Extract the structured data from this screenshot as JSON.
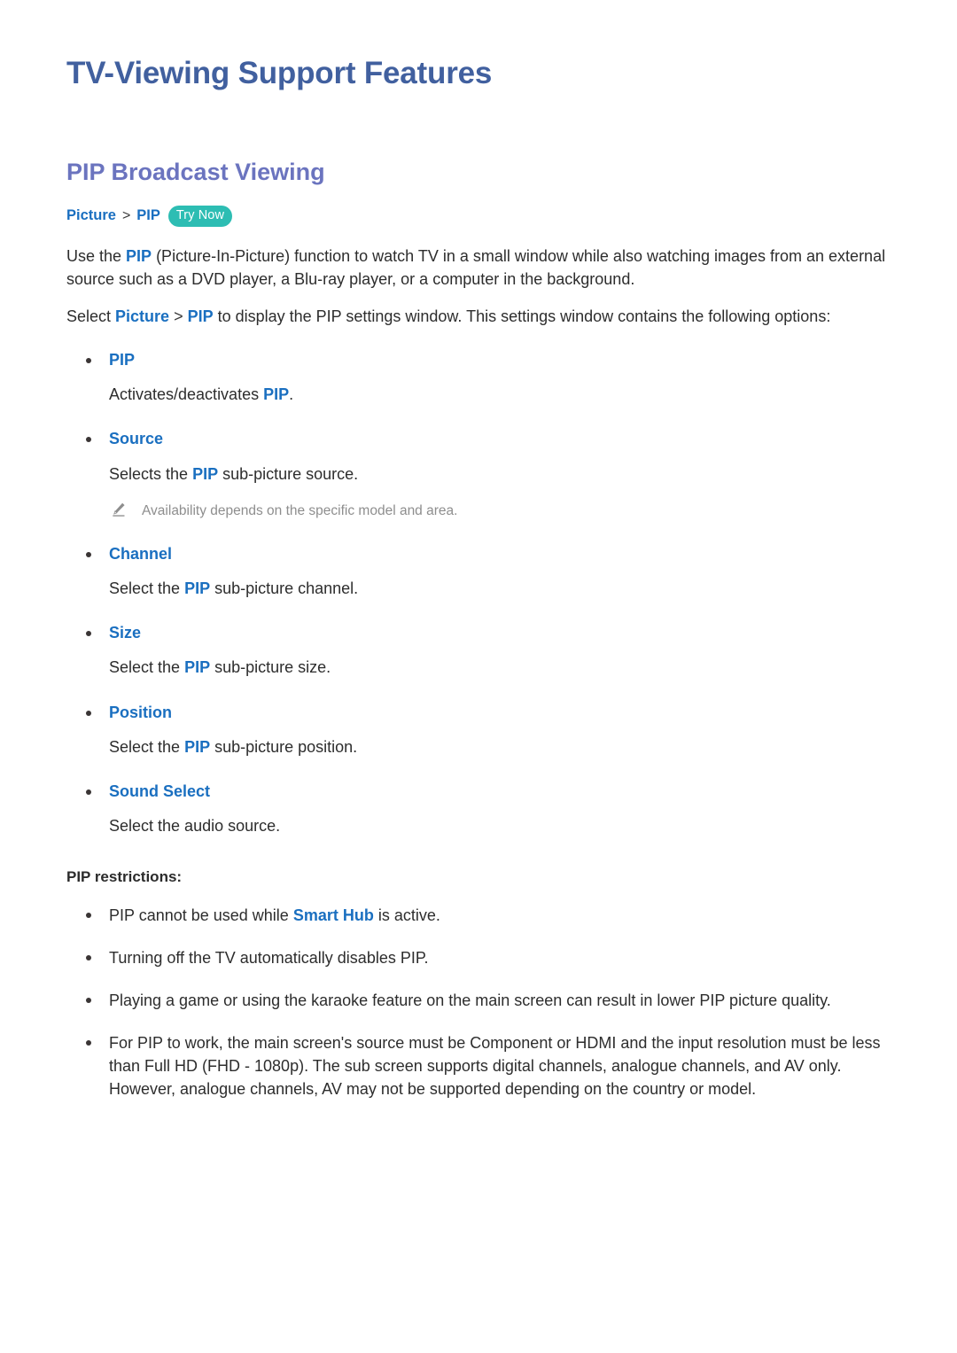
{
  "document": {
    "title": "TV-Viewing Support Features",
    "section_title": "PIP Broadcast Viewing"
  },
  "breadcrumb": {
    "first": "Picture",
    "separator": ">",
    "second": "PIP",
    "badge": "Try Now"
  },
  "intro": {
    "p1_a": "Use the ",
    "p1_kw": "PIP",
    "p1_b": " (Picture-In-Picture) function to watch TV in a small window while also watching images from an external source such as a DVD player, a Blu-ray player, or a computer in the background.",
    "p2_a": "Select ",
    "p2_kw1": "Picture",
    "p2_sep": " > ",
    "p2_kw2": "PIP",
    "p2_b": " to display the PIP settings window. This settings window contains the following options:"
  },
  "options": [
    {
      "label": "PIP",
      "desc_a": "Activates/deactivates ",
      "desc_kw": "PIP",
      "desc_b": ".",
      "note": null
    },
    {
      "label": "Source",
      "desc_a": "Selects the ",
      "desc_kw": "PIP",
      "desc_b": " sub-picture source.",
      "note": "Availability depends on the specific model and area."
    },
    {
      "label": "Channel",
      "desc_a": "Select the ",
      "desc_kw": "PIP",
      "desc_b": " sub-picture channel.",
      "note": null
    },
    {
      "label": "Size",
      "desc_a": "Select the ",
      "desc_kw": "PIP",
      "desc_b": " sub-picture size.",
      "note": null
    },
    {
      "label": "Position",
      "desc_a": "Select the ",
      "desc_kw": "PIP",
      "desc_b": " sub-picture position.",
      "note": null
    },
    {
      "label": "Sound Select",
      "desc_a": "Select the audio source.",
      "desc_kw": "",
      "desc_b": "",
      "note": null
    }
  ],
  "restrictions": {
    "title": "PIP restrictions:",
    "items": [
      {
        "text_a": "PIP cannot be used while ",
        "kw": "Smart Hub",
        "text_b": " is active."
      },
      {
        "text_a": "Turning off the TV automatically disables PIP.",
        "kw": "",
        "text_b": ""
      },
      {
        "text_a": "Playing a game or using the karaoke feature on the main screen can result in lower PIP picture quality.",
        "kw": "",
        "text_b": ""
      },
      {
        "text_a": "For PIP to work, the main screen's source must be Component or HDMI and the input resolution must be less than Full HD (FHD - 1080p). The sub screen supports digital channels, analogue channels, and AV only. However, analogue channels, AV may not be supported depending on the country or model.",
        "kw": "",
        "text_b": ""
      }
    ]
  },
  "icons": {
    "note_icon": "pencil-icon",
    "bullet": "bullet-dot"
  },
  "colors": {
    "title_blue": "#41609f",
    "section_blue": "#6b74bf",
    "keyword_blue": "#1a6fc0",
    "badge_teal": "#2dbdb3",
    "note_gray": "#8e8e8e",
    "body_text": "#2d2d2d"
  }
}
